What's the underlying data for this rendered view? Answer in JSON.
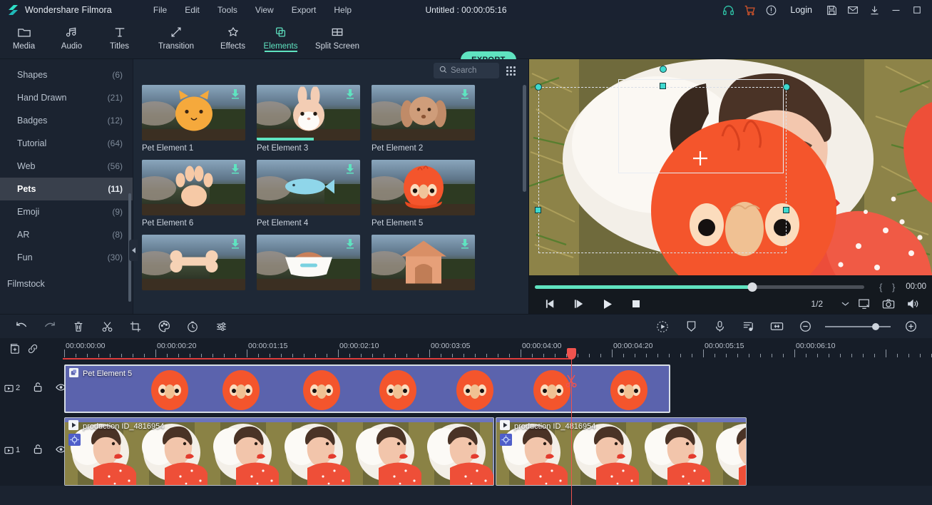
{
  "app": {
    "brand": "Wondershare Filmora",
    "project_title": "Untitled : 00:00:05:16",
    "menu": [
      "File",
      "Edit",
      "Tools",
      "View",
      "Export",
      "Help"
    ],
    "login_label": "Login",
    "accent": "#5fe3c0",
    "titlebar_icons": [
      "headset-icon",
      "cart-icon",
      "info-icon"
    ],
    "window_icons": [
      "save-icon",
      "mail-icon",
      "download-icon",
      "minimize-icon",
      "maximize-icon"
    ]
  },
  "toolbar": {
    "items": [
      {
        "label": "Media",
        "icon": "folder-icon",
        "active": false
      },
      {
        "label": "Audio",
        "icon": "music-note-icon",
        "active": false
      },
      {
        "label": "Titles",
        "icon": "text-t-icon",
        "active": false
      },
      {
        "label": "Transition",
        "icon": "transition-arrows-icon",
        "active": false
      },
      {
        "label": "Effects",
        "icon": "star-effects-icon",
        "active": false
      },
      {
        "label": "Elements",
        "icon": "layers-icon",
        "active": true
      },
      {
        "label": "Split Screen",
        "icon": "split-screen-icon",
        "active": false
      }
    ],
    "export_label": "EXPORT"
  },
  "library": {
    "categories": [
      {
        "name": "Shapes",
        "count": "(6)",
        "selected": false
      },
      {
        "name": "Hand Drawn",
        "count": "(21)",
        "selected": false
      },
      {
        "name": "Badges",
        "count": "(12)",
        "selected": false
      },
      {
        "name": "Tutorial",
        "count": "(64)",
        "selected": false
      },
      {
        "name": "Web",
        "count": "(56)",
        "selected": false
      },
      {
        "name": "Pets",
        "count": "(11)",
        "selected": true
      },
      {
        "name": "Emoji",
        "count": "(9)",
        "selected": false
      },
      {
        "name": "AR",
        "count": "(8)",
        "selected": false
      },
      {
        "name": "Fun",
        "count": "(30)",
        "selected": false
      }
    ],
    "filmstock_label": "Filmstock",
    "search": {
      "placeholder": "Search",
      "value": "",
      "icon": "search-icon"
    },
    "grid_toggle_icon": "grid-view-icon",
    "items": [
      {
        "label": "Pet Element 1",
        "art": "cat",
        "downloadable": true,
        "progress": 0
      },
      {
        "label": "Pet Element 3",
        "art": "rabbit",
        "downloadable": true,
        "progress": 55
      },
      {
        "label": "Pet Element 2",
        "art": "dog",
        "downloadable": true,
        "progress": 0
      },
      {
        "label": "Pet Element 6",
        "art": "paw",
        "downloadable": true,
        "progress": 0
      },
      {
        "label": "Pet Element 4",
        "art": "fish",
        "downloadable": true,
        "progress": 0
      },
      {
        "label": "Pet Element 5",
        "art": "bird",
        "downloadable": false,
        "progress": 0
      },
      {
        "label": "",
        "art": "bone",
        "downloadable": true,
        "progress": 0
      },
      {
        "label": "",
        "art": "bowl",
        "downloadable": true,
        "progress": 0
      },
      {
        "label": "",
        "art": "house",
        "downloadable": true,
        "progress": 0
      }
    ]
  },
  "preview": {
    "current_time": "00:00",
    "progress_percent": 66,
    "mark_in": "{",
    "mark_out": "}",
    "controls": [
      {
        "name": "prev-frame-button",
        "icon": "step-back-icon"
      },
      {
        "name": "next-frame-button",
        "icon": "step-forward-icon"
      },
      {
        "name": "play-button",
        "icon": "play-icon"
      },
      {
        "name": "stop-button",
        "icon": "stop-icon"
      }
    ],
    "quality_label": "1/2",
    "right_icons": [
      "snapshot-screen-icon",
      "camera-icon",
      "volume-icon"
    ]
  },
  "timeline": {
    "left_tools": [
      {
        "name": "undo-button",
        "icon": "undo-icon"
      },
      {
        "name": "redo-button",
        "icon": "redo-icon"
      },
      {
        "name": "delete-button",
        "icon": "trash-icon"
      },
      {
        "name": "split-button",
        "icon": "scissors-icon"
      },
      {
        "name": "crop-button",
        "icon": "crop-icon"
      },
      {
        "name": "color-button",
        "icon": "palette-icon"
      },
      {
        "name": "speed-button",
        "icon": "clock-icon"
      },
      {
        "name": "adjust-button",
        "icon": "sliders-icon"
      }
    ],
    "right_tools": [
      {
        "name": "motion-tracking-button",
        "icon": "motion-track-icon"
      },
      {
        "name": "marker-button",
        "icon": "marker-shield-icon"
      },
      {
        "name": "record-voiceover-button",
        "icon": "microphone-icon"
      },
      {
        "name": "audio-mixer-button",
        "icon": "audio-mixer-icon"
      },
      {
        "name": "fit-timeline-button",
        "icon": "fit-width-icon"
      },
      {
        "name": "zoom-out-button",
        "icon": "minus-circle-icon"
      },
      {
        "name": "zoom-in-button",
        "icon": "plus-circle-icon"
      }
    ],
    "zoom_value": 72,
    "row_icons": [
      {
        "name": "add-track-button",
        "icon": "add-layer-icon"
      },
      {
        "name": "link-clips-button",
        "icon": "link-icon"
      }
    ],
    "ruler_labels": [
      "00:00:00:00",
      "00:00:00:20",
      "00:00:01:15",
      "00:00:02:10",
      "00:00:03:05",
      "00:00:04:00",
      "00:00:04:20",
      "00:00:05:15",
      "00:00:06:10"
    ],
    "playhead_time": "00:00:04:00",
    "tracks": [
      {
        "num": "2",
        "lock_icon": "unlock-icon",
        "eye_icon": "eye-icon",
        "clips": [
          {
            "label": "Pet Element 5",
            "type": "element",
            "selected": true,
            "icon": "element-clip-icon"
          }
        ]
      },
      {
        "num": "1",
        "lock_icon": "unlock-icon",
        "eye_icon": "eye-icon",
        "clips": [
          {
            "label": "production ID_4816954",
            "type": "video",
            "selected": false,
            "icon": "video-clip-icon",
            "badge_icon": "transform-badge-icon"
          },
          {
            "label": "production ID_4816954",
            "type": "video",
            "selected": false,
            "icon": "video-clip-icon",
            "badge_icon": "transform-badge-icon"
          }
        ]
      }
    ]
  }
}
